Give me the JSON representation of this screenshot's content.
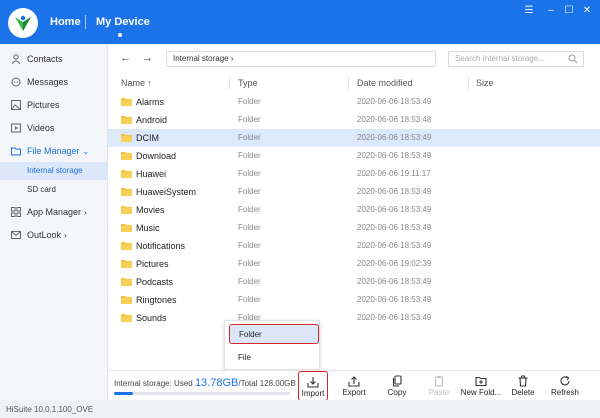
{
  "header": {
    "home_label": "Home",
    "device_label": "My Device",
    "brand_color": "#1a73e8"
  },
  "sidebar": {
    "items": [
      {
        "label": "Contacts",
        "icon": "person-icon"
      },
      {
        "label": "Messages",
        "icon": "chat-icon"
      },
      {
        "label": "Pictures",
        "icon": "picture-icon"
      },
      {
        "label": "Videos",
        "icon": "video-icon"
      },
      {
        "label": "File Manager",
        "icon": "folder-icon"
      },
      {
        "label": "App Manager",
        "icon": "grid-icon"
      },
      {
        "label": "OutLook",
        "icon": "mail-icon"
      }
    ],
    "file_manager_sub": [
      "Internal storage",
      "SD card"
    ]
  },
  "path": {
    "location": "Internal storage",
    "search_placeholder": "Search Internal storage..."
  },
  "table": {
    "columns": [
      "Name",
      "Type",
      "Date modified",
      "Size"
    ],
    "sort_indicator": "↑",
    "rows": [
      {
        "name": "Alarms",
        "type": "Folder",
        "date": "2020-06-06 18:53:49"
      },
      {
        "name": "Android",
        "type": "Folder",
        "date": "2020-06-06 18:53:48"
      },
      {
        "name": "DCIM",
        "type": "Folder",
        "date": "2020-06-06 18:53:49"
      },
      {
        "name": "Download",
        "type": "Folder",
        "date": "2020-06-06 18:53:49"
      },
      {
        "name": "Huawei",
        "type": "Folder",
        "date": "2020-06-06 19:11:17"
      },
      {
        "name": "HuaweiSystem",
        "type": "Folder",
        "date": "2020-06-06 18:53:49"
      },
      {
        "name": "Movies",
        "type": "Folder",
        "date": "2020-06-06 18:53:49"
      },
      {
        "name": "Music",
        "type": "Folder",
        "date": "2020-06-06 18:53:49"
      },
      {
        "name": "Notifications",
        "type": "Folder",
        "date": "2020-06-06 18:53:49"
      },
      {
        "name": "Pictures",
        "type": "Folder",
        "date": "2020-06-06 19:02:39"
      },
      {
        "name": "Podcasts",
        "type": "Folder",
        "date": "2020-06-06 18:53:49"
      },
      {
        "name": "Ringtones",
        "type": "Folder",
        "date": "2020-06-06 18:53:49"
      },
      {
        "name": "Sounds",
        "type": "Folder",
        "date": "2020-06-06 18:53:49"
      }
    ]
  },
  "import_menu": {
    "items": [
      "Folder",
      "File"
    ]
  },
  "storage": {
    "prefix": "Internal storage: Used ",
    "used": "13.78GB",
    "total": "/Total 128.00GB",
    "used_fraction": 0.108
  },
  "toolbar": {
    "import": "Import",
    "export": "Export",
    "copy": "Copy",
    "paste": "Paste",
    "new_folder": "New Fold...",
    "delete": "Delete",
    "refresh": "Refresh"
  },
  "status": {
    "version": "HiSuite 10.0.1.100_OVE"
  }
}
